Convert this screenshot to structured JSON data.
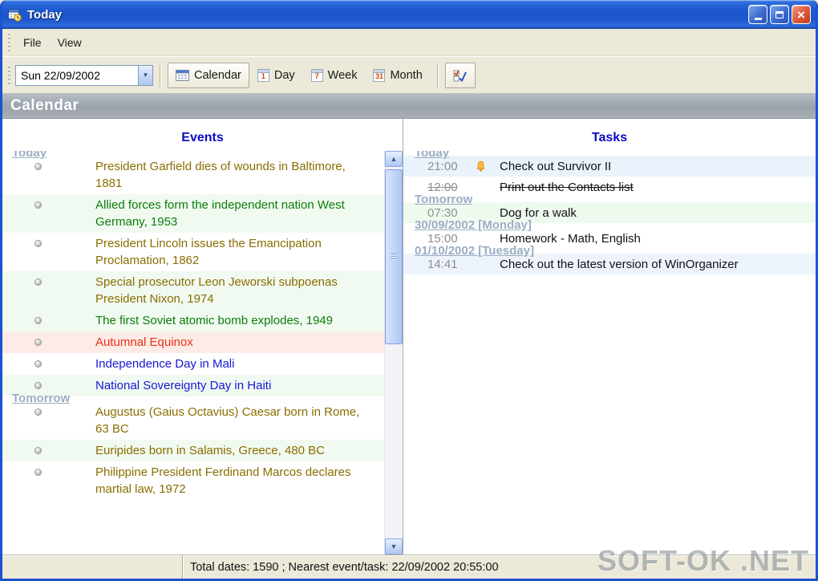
{
  "window": {
    "title": "Today"
  },
  "menu": {
    "items": [
      "File",
      "View"
    ]
  },
  "toolbar": {
    "date_value": "Sun 22/09/2002",
    "calendar_label": "Calendar",
    "view_buttons": [
      {
        "label": "Day",
        "badge": "1"
      },
      {
        "label": "Week",
        "badge": "7"
      },
      {
        "label": "Month",
        "badge": "31"
      }
    ]
  },
  "icons": {
    "close": "×",
    "combo_arrow": "▼",
    "scroll_up": "▲",
    "scroll_down": "▼"
  },
  "banner": {
    "title": "Calendar"
  },
  "colors": {
    "pane_header": "#0a0ac8",
    "group_label": "#9badc2",
    "time_text": "#8f8f8f",
    "banner_text": "#ffffff"
  },
  "events_pane": {
    "header": "Events",
    "groups": [
      {
        "label": "Today",
        "items": [
          {
            "text": "President Garfield dies of wounds in Baltimore, 1881",
            "color": "#8a6d00",
            "bg": "#ffffff"
          },
          {
            "text": "Allied forces form the independent nation West Germany, 1953",
            "color": "#0b7d0b",
            "bg": "#f1faf1"
          },
          {
            "text": "President Lincoln issues the Emancipation Proclamation, 1862",
            "color": "#8a6d00",
            "bg": "#ffffff"
          },
          {
            "text": "Special prosecutor Leon Jeworski subpoenas President Nixon, 1974",
            "color": "#8a6d00",
            "bg": "#f1faf1"
          },
          {
            "text": "The first Soviet atomic bomb explodes, 1949",
            "color": "#0b7d0b",
            "bg": "#f1faf1"
          },
          {
            "text": "Autumnal Equinox",
            "color": "#ee3018",
            "bg": "#fcebe6"
          },
          {
            "text": "Independence Day in Mali",
            "color": "#1616d6",
            "bg": "#ffffff"
          },
          {
            "text": "National Sovereignty Day in Haiti",
            "color": "#1616d6",
            "bg": "#f1faf1"
          }
        ]
      },
      {
        "label": "Tomorrow",
        "items": [
          {
            "text": "Augustus (Gaius Octavius) Caesar born in Rome, 63 BC",
            "color": "#8a6d00",
            "bg": "#ffffff"
          },
          {
            "text": "Euripides born in Salamis, Greece, 480 BC",
            "color": "#8a6d00",
            "bg": "#f1faf1"
          },
          {
            "text": "Philippine President Ferdinand Marcos declares martial law, 1972",
            "color": "#8a6d00",
            "bg": "#ffffff"
          }
        ]
      }
    ]
  },
  "tasks_pane": {
    "header": "Tasks",
    "groups": [
      {
        "label": "Today",
        "items": [
          {
            "time": "21:00",
            "text": "Check out Survivor II",
            "bell": true,
            "done": false,
            "bg": "#eaf2fb"
          },
          {
            "time": "12:00",
            "text": "Print out the Contacts list",
            "bell": false,
            "done": true,
            "bg": "#ffffff"
          }
        ]
      },
      {
        "label": "Tomorrow",
        "items": [
          {
            "time": "07:30",
            "text": "Dog for a walk",
            "bell": false,
            "done": false,
            "bg": "#effaef"
          }
        ]
      },
      {
        "label": "30/09/2002 [Monday]",
        "items": [
          {
            "time": "15:00",
            "text": "Homework - Math, English",
            "bell": false,
            "done": false,
            "bg": "#ffffff"
          }
        ]
      },
      {
        "label": "01/10/2002 [Tuesday]",
        "items": [
          {
            "time": "14:41",
            "text": "Check out the latest version of WinOrganizer",
            "bell": false,
            "done": false,
            "bg": "#edf3fa"
          }
        ]
      }
    ]
  },
  "statusbar": {
    "text": "Total dates: 1590 ; Nearest event/task: 22/09/2002 20:55:00"
  },
  "watermark": "SOFT-OK .NET"
}
